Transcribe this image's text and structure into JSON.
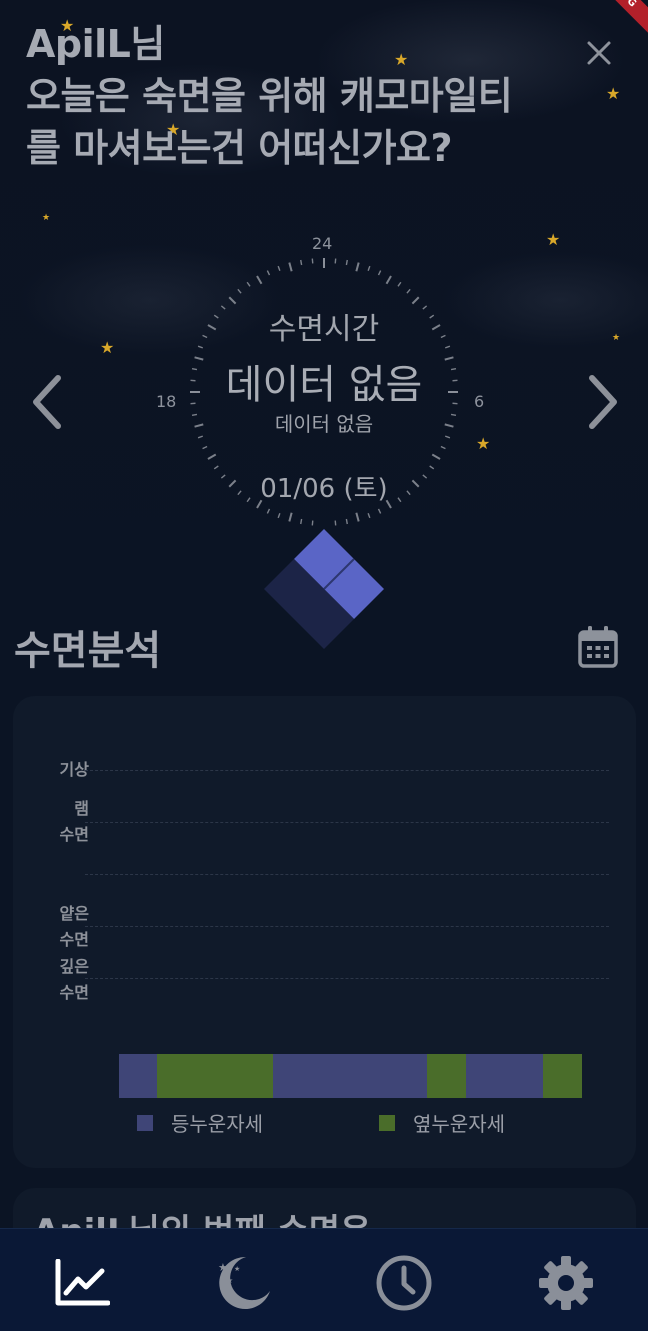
{
  "header": {
    "greeting": "ApilL님\n오늘은 숙면을 위해 캐모마일티\n를 마셔보는건 어떠신가요?",
    "debug_banner": "G"
  },
  "clock": {
    "label_24": "24",
    "label_18": "18",
    "label_6": "6",
    "title": "수면시간",
    "value": "데이터 없음",
    "subvalue": "데이터 없음",
    "date": "01/06 (토)"
  },
  "analysis": {
    "title": "수면분석",
    "stages": [
      "기상",
      "램\n수면",
      "얕은\n수면",
      "깊은\n수면"
    ],
    "posture_segments": [
      {
        "posture": "back",
        "fraction": 0.083
      },
      {
        "posture": "side",
        "fraction": 0.25
      },
      {
        "posture": "back",
        "fraction": 0.333
      },
      {
        "posture": "side",
        "fraction": 0.083
      },
      {
        "posture": "back",
        "fraction": 0.167
      },
      {
        "posture": "side",
        "fraction": 0.084
      }
    ],
    "legend": [
      {
        "label": "등누운자세",
        "color": "#3f4577"
      },
      {
        "label": "옆누운자세",
        "color": "#4a6d2a"
      }
    ]
  },
  "next_card": {
    "title": "ApilL님의 번째 수면은"
  },
  "bottom_nav": [
    {
      "icon": "chart-icon",
      "active": true
    },
    {
      "icon": "moon-icon",
      "active": false
    },
    {
      "icon": "clock-icon",
      "active": false
    },
    {
      "icon": "gear-icon",
      "active": false
    }
  ],
  "colors": {
    "background": "#0b1424",
    "card": "#101a2a",
    "star": "#d9a82a",
    "cube_light": "#5a65c6",
    "cube_dark": "#1c2447",
    "nav_bar": "#0a1836"
  }
}
